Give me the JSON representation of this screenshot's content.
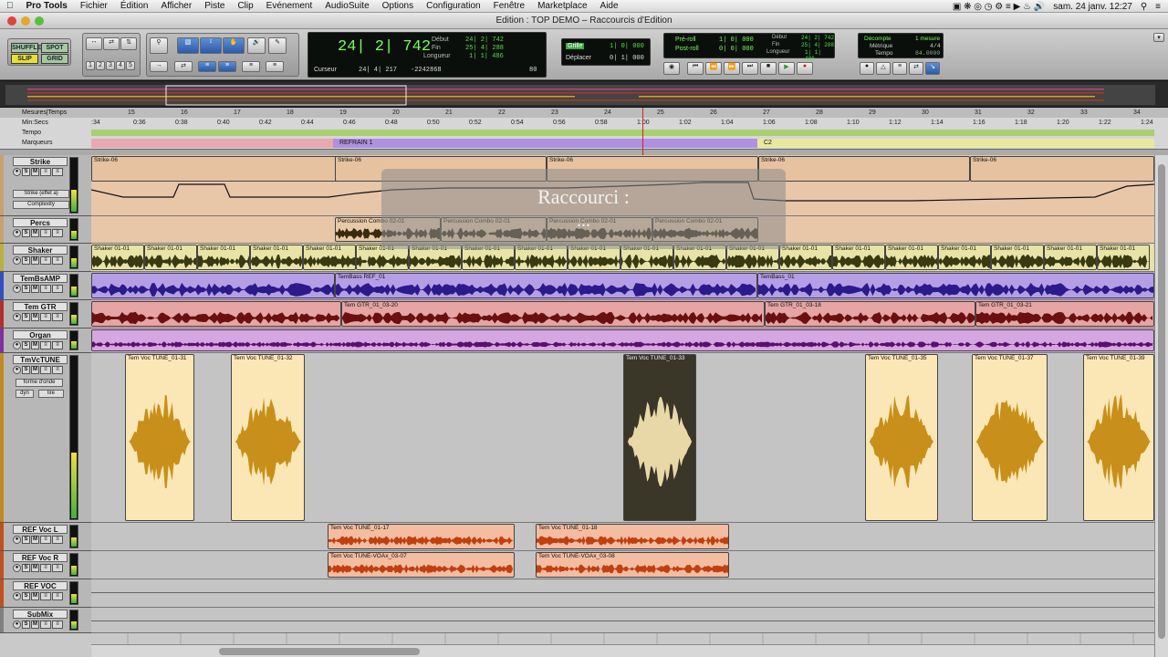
{
  "menubar": {
    "app": "Pro Tools",
    "items": [
      "Fichier",
      "Édition",
      "Afficher",
      "Piste",
      "Clip",
      "Evénement",
      "AudioSuite",
      "Options",
      "Configuration",
      "Fenêtre",
      "Marketplace",
      "Aide"
    ],
    "clock": "sam. 24 janv.  12:27"
  },
  "window": {
    "title": "Edition : TOP DEMO – Raccourcis d'Edition"
  },
  "toolbar": {
    "modes": [
      "SHUFFLE",
      "SPOT",
      "SLIP",
      "GRID"
    ],
    "zoom_presets": [
      "1",
      "2",
      "3",
      "4",
      "5"
    ],
    "main_counter": "24| 2| 742",
    "start_label": "Début",
    "start": "24| 2| 742",
    "end_label": "Fin",
    "end": "25| 4| 288",
    "length_label": "Longueur",
    "length": "1| 1| 486",
    "cursor_label": "Curseur",
    "cursor": "24| 4| 217",
    "cursor_sample": "-2242868",
    "grid_label": "Grille",
    "grid": "1| 0| 000",
    "nudge_label": "Déplacer",
    "nudge": "0| 1| 000",
    "preroll_label": "Pré-roll",
    "preroll": "1| 0| 000",
    "postroll_label": "Post-roll",
    "postroll": "0| 0| 000",
    "t_start": "24| 2| 742",
    "t_end": "25| 4| 288",
    "t_len": "1| 1| 486",
    "countoff_label": "Décompte",
    "countoff": "1 mesure",
    "meter_label": "Métrique",
    "meter": "4/4",
    "tempo_label": "Tempo",
    "tempo": "84.0000",
    "tempo_small": "80"
  },
  "rulers": {
    "bars_label": "Mesures|Temps",
    "min_label": "Min:Secs",
    "tempo_label": "Tempo",
    "markers_label": "Marqueurs",
    "bars": [
      "15",
      "16",
      "17",
      "18",
      "19",
      "20",
      "21",
      "22",
      "23",
      "24",
      "25",
      "26",
      "27",
      "28",
      "29",
      "30",
      "31",
      "32",
      "33",
      "34"
    ],
    "mins": [
      ":34",
      "0:36",
      "0:38",
      "0:40",
      "0:42",
      "0:44",
      "0:46",
      "0:48",
      "0:50",
      "0:52",
      "0:54",
      "0:56",
      "0:58",
      "1:00",
      "1:02",
      "1:04",
      "1:06",
      "1:08",
      "1:10",
      "1:12",
      "1:14",
      "1:16",
      "1:18",
      "1:20",
      "1:22",
      "1:24"
    ],
    "marker1": "REFRAIN 1",
    "marker2": "C2"
  },
  "tracks": [
    {
      "name": "Strike",
      "color": "#c9a070",
      "insert": "Strike (effet a)",
      "param": "Complexity"
    },
    {
      "name": "Percs",
      "color": "#c9a070"
    },
    {
      "name": "Shaker",
      "color": "#b8b040"
    },
    {
      "name": "TemBsAMP",
      "color": "#3050c0"
    },
    {
      "name": "Tem GTR",
      "color": "#b03030"
    },
    {
      "name": "Organ",
      "color": "#8030a0"
    },
    {
      "name": "TmVcTUNE",
      "color": "#c08a20",
      "view": "forme d'onde",
      "mode": "dyn",
      "auto": "lire"
    },
    {
      "name": "REF Voc L",
      "color": "#c05020"
    },
    {
      "name": "REF Voc R",
      "color": "#c05020"
    },
    {
      "name": "REF VOC",
      "color": "#c05020"
    },
    {
      "name": "SubMix",
      "color": "#808080"
    }
  ],
  "clips": {
    "strike": [
      "Strike-06",
      "Strike-06",
      "Strike-06",
      "Strike-06",
      "Strike-06"
    ],
    "percs": [
      "Percussion Combo 02-01",
      "Percussion Combo 02-01",
      "Percussion Combo 02-01",
      "Percussion Combo 02-01"
    ],
    "shaker": "Shaker 01-01",
    "bass": [
      "TemBass REF_01",
      "TemBass_01"
    ],
    "gtr": [
      "Tem GTR_01_03-20",
      "Tem GTR_01_03-18",
      "Tem GTR_01_03-21"
    ],
    "voc": [
      "Tem Voc TUNE_01-31",
      "Tem Voc TUNE_01-32",
      "Tem Voc TUNE_01-33",
      "Tem Voc TUNE_01-35",
      "Tem Voc TUNE_01-37",
      "Tem Voc TUNE_01-39"
    ],
    "refl": [
      "Tem Voc TUNE_01-17",
      "Tem Voc TUNE_01-18"
    ],
    "refr": [
      "Tem Voc TUNE-VOAx_03-07",
      "Tem Voc TUNE-VOAx_03-08"
    ]
  },
  "overlay": {
    "line1": "Raccourci :",
    "line2": "..."
  }
}
